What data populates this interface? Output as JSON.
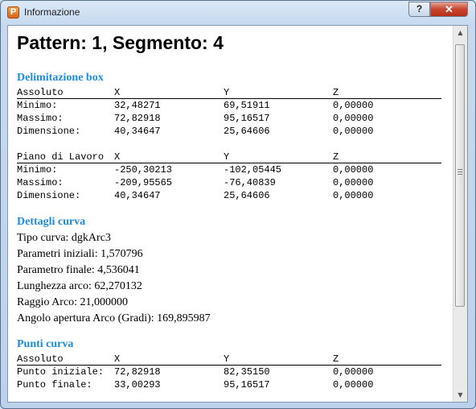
{
  "window": {
    "title": "Informazione",
    "app_icon": "P",
    "help_label": "?",
    "close_label": "✕"
  },
  "page_title": "Pattern: 1, Segmento: 4",
  "bbox": {
    "title": "Delimitazione box",
    "tables": [
      {
        "header": [
          "Assoluto",
          "X",
          "Y",
          "Z"
        ],
        "rows": [
          [
            "Minimo:",
            "32,48271",
            "69,51911",
            "0,00000"
          ],
          [
            "Massimo:",
            "72,82918",
            "95,16517",
            "0,00000"
          ],
          [
            "Dimensione:",
            "40,34647",
            "25,64606",
            "0,00000"
          ]
        ]
      },
      {
        "header": [
          "Piano di Lavoro",
          "X",
          "Y",
          "Z"
        ],
        "rows": [
          [
            "Minimo:",
            "-250,30213",
            "-102,05445",
            "0,00000"
          ],
          [
            "Massimo:",
            "-209,95565",
            "-76,40839",
            "0,00000"
          ],
          [
            "Dimensione:",
            "40,34647",
            "25,64606",
            "0,00000"
          ]
        ]
      }
    ]
  },
  "curve": {
    "title": "Dettagli curva",
    "lines": [
      "Tipo curva: dgkArc3",
      "Parametri iniziali: 1,570796",
      "Parametro finale: 4,536041",
      "Lunghezza arco: 62,270132",
      "Raggio Arco: 21,000000",
      "Angolo apertura Arco (Gradi): 169,895987"
    ]
  },
  "points": {
    "title": "Punti curva",
    "header": [
      "Assoluto",
      "X",
      "Y",
      "Z"
    ],
    "rows": [
      [
        "Punto iniziale:",
        "72,82918",
        "82,35150",
        "0,00000"
      ],
      [
        "Punto finale:",
        "33,00293",
        "95,16517",
        "0,00000"
      ]
    ]
  }
}
